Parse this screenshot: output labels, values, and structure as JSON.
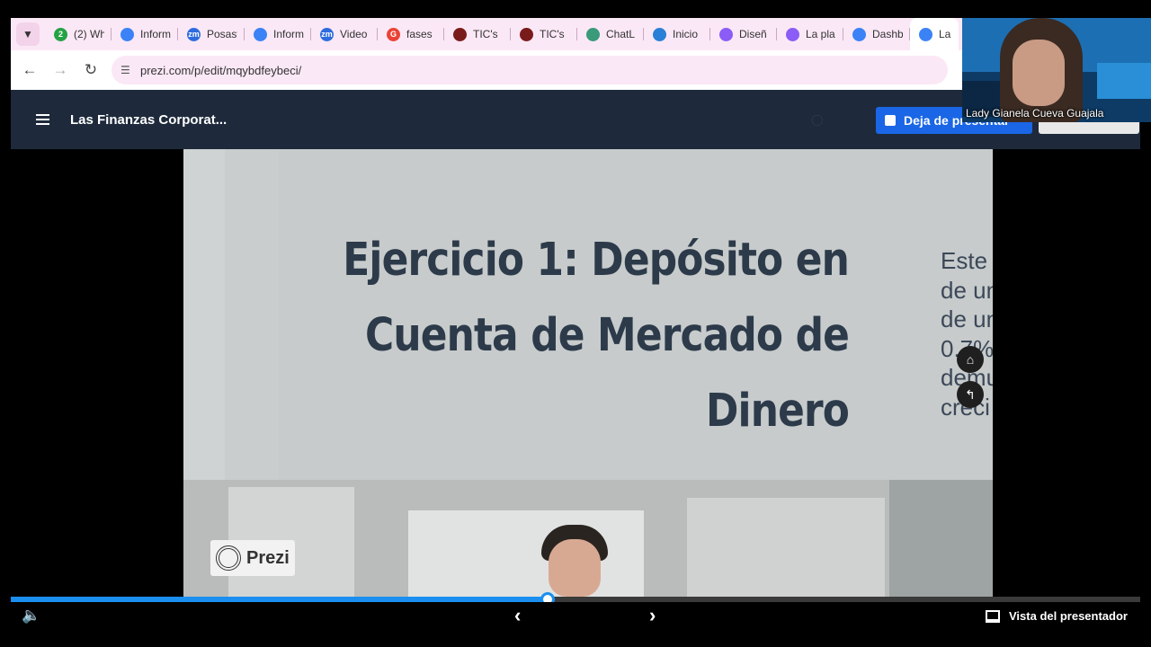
{
  "browser": {
    "tab_menu_icon": "chevron-down-icon",
    "tabs": [
      {
        "label": "(2) Wh",
        "badge": "2",
        "icon_color": "#25a244"
      },
      {
        "label": "Inform",
        "icon_color": "#3b82f6"
      },
      {
        "label": "Posast",
        "badge": "zm",
        "icon_color": "#2d6cdf"
      },
      {
        "label": "Inform",
        "icon_color": "#3b82f6"
      },
      {
        "label": "Video",
        "badge": "zm",
        "icon_color": "#2d6cdf"
      },
      {
        "label": "fases",
        "badge": "G",
        "icon_color": "#ea4335"
      },
      {
        "label": "TIC's",
        "icon_color": "#7a1b1b"
      },
      {
        "label": "TIC's",
        "icon_color": "#7a1b1b"
      },
      {
        "label": "ChatL",
        "icon_color": "#3a9a7a"
      },
      {
        "label": "Inicio",
        "icon_color": "#2a7fd6"
      },
      {
        "label": "Diseñ",
        "icon_color": "#8b5cf6"
      },
      {
        "label": "La pla",
        "icon_color": "#8b5cf6"
      },
      {
        "label": "Dashb",
        "icon_color": "#3b82f6"
      },
      {
        "label": "La",
        "icon_color": "#3b82f6"
      }
    ],
    "url": "prezi.com/p/edit/mqybdfeybeci/"
  },
  "prezi": {
    "title": "Las Finanzas Corporat...",
    "present_label": "Deja de presentar",
    "slide": {
      "heading_line1": "Ejercicio 1: Depósito en",
      "heading_line2": "Cuenta de Mercado de Dinero",
      "side_lines": [
        "Este",
        "de un",
        "de un",
        "0.7%",
        "demu",
        "creci"
      ]
    },
    "logo_text": "Prezi",
    "presenter_view_label": "Vista del presentador",
    "progress_fraction": 0.475
  },
  "webcam": {
    "name": "Lady Gianela Cueva Guajala"
  }
}
